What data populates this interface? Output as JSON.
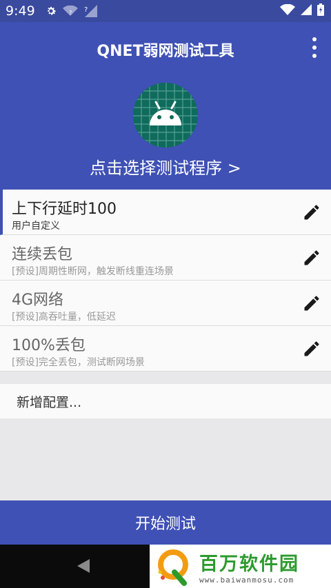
{
  "status_bar": {
    "time": "9:49",
    "network_label": "?"
  },
  "header": {
    "app_title": "QNET弱网测试工具",
    "select_program": "点击选择测试程序 >"
  },
  "profiles": [
    {
      "title": "上下行延时100",
      "subtitle": "用户自定义",
      "selected": true
    },
    {
      "title": "连续丢包",
      "subtitle": "[预设]周期性断网，触发断线重连场景",
      "selected": false
    },
    {
      "title": "4G网络",
      "subtitle": "[预设]高吞吐量，低延迟",
      "selected": false
    },
    {
      "title": "100%丢包",
      "subtitle": "[预设]完全丢包，测试断网场景",
      "selected": false
    }
  ],
  "add_config_label": "新增配置...",
  "start_button_label": "开始测试",
  "watermark": {
    "title": "百万软件园",
    "url": "www.baiwanmosu.com"
  },
  "colors": {
    "primary": "#3f51b5",
    "status_bar": "#3a4a9f",
    "icon_bg": "#0f6b5c",
    "android_green": "#a4c639"
  }
}
